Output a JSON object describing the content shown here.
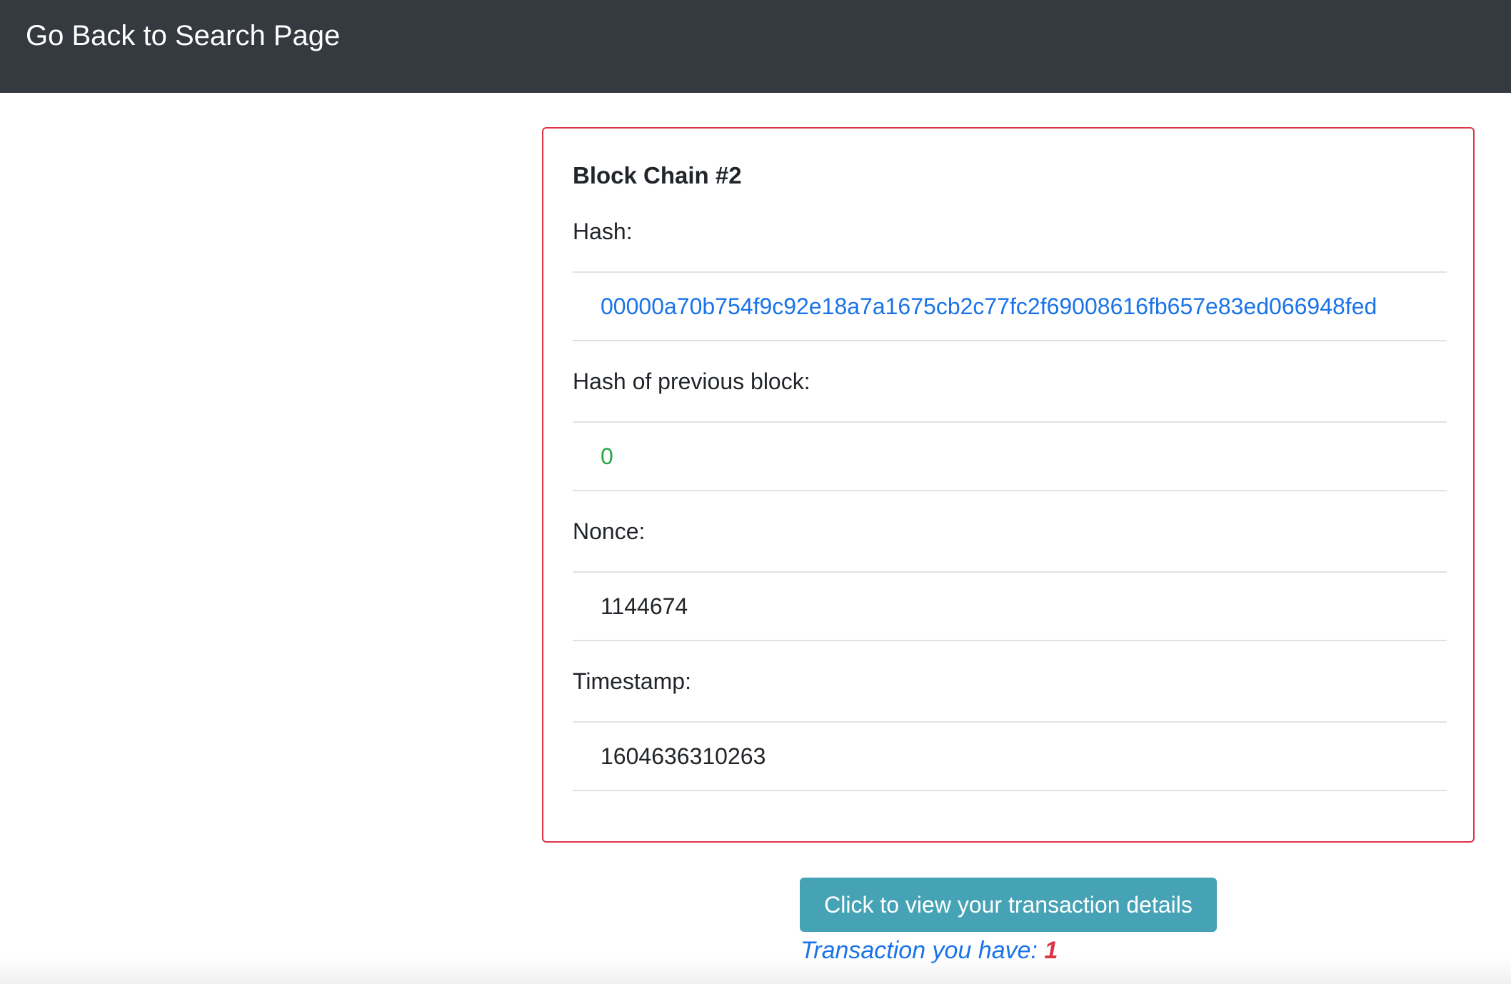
{
  "navbar": {
    "back_link": "Go Back to Search Page"
  },
  "block": {
    "title": "Block Chain #2",
    "hash_label": "Hash:",
    "hash_value": "00000a70b754f9c92e18a7a1675cb2c77fc2f69008616fb657e83ed066948fed",
    "prev_hash_label": "Hash of previous block:",
    "prev_hash_value": "0",
    "nonce_label": "Nonce:",
    "nonce_value": "1144674",
    "timestamp_label": "Timestamp:",
    "timestamp_value": "1604636310263"
  },
  "actions": {
    "view_transactions_button": "Click to view your transaction details",
    "transaction_count_label": "Transaction you have:",
    "transaction_count": "1"
  },
  "colors": {
    "navbar_bg": "#343a40",
    "card_border": "#dc3545",
    "hash_link": "#1a73e8",
    "prev_hash": "#28a745",
    "button_bg": "#46a2b5",
    "count": "#dc3545"
  }
}
